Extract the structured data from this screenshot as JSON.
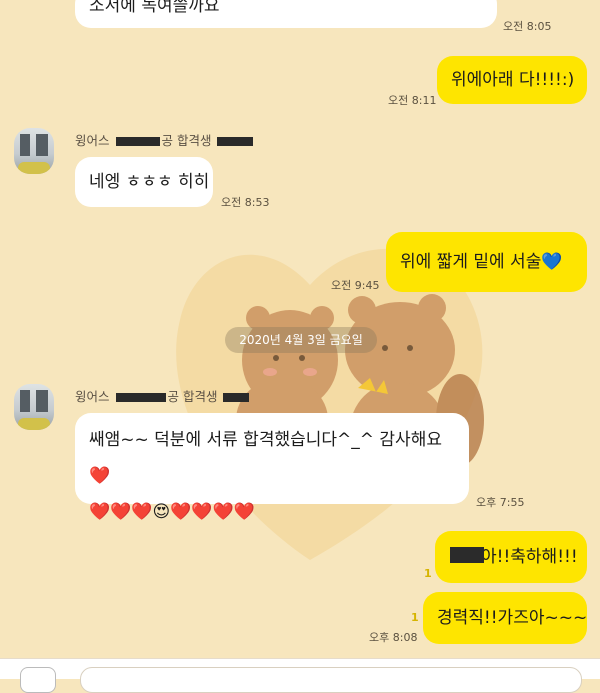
{
  "messages": {
    "m1_text": "소서에 녹여쓸까요",
    "m1_time": "오전 8:05",
    "m2_text": "위에아래 다!!!!:)",
    "m2_time": "오전 8:11",
    "m3_sender_prefix": "윙어스",
    "m3_sender_suffix": "공 합격생",
    "m3_text": "네엥 ㅎㅎㅎ 히히",
    "m3_time": "오전 8:53",
    "m4_text": "위에 짧게 밑에 서술💙",
    "m4_time": "오전 9:45",
    "date_divider": "2020년 4월 3일 금요일",
    "m5_sender_prefix": "윙어스",
    "m5_sender_suffix": "공 합격생",
    "m5_line1": "쌔앰~~ 덕분에 서류 합격했습니다^_^ 감사해요❤️",
    "m5_line2": "❤️❤️❤️😍❤️❤️❤️❤️",
    "m5_time": "오후 7:55",
    "m6_text": "아!!축하해!!!",
    "m6_unread": "1",
    "m7_text": "경력직!!가즈아~~~",
    "m7_unread": "1",
    "m7_time": "오후 8:08"
  },
  "colors": {
    "background": "#f7e6bd",
    "my_bubble": "#fee500",
    "their_bubble": "#ffffff",
    "unread": "#d6b400"
  },
  "icons": {
    "avatar": "profile-photo",
    "plus": "plus-icon"
  }
}
